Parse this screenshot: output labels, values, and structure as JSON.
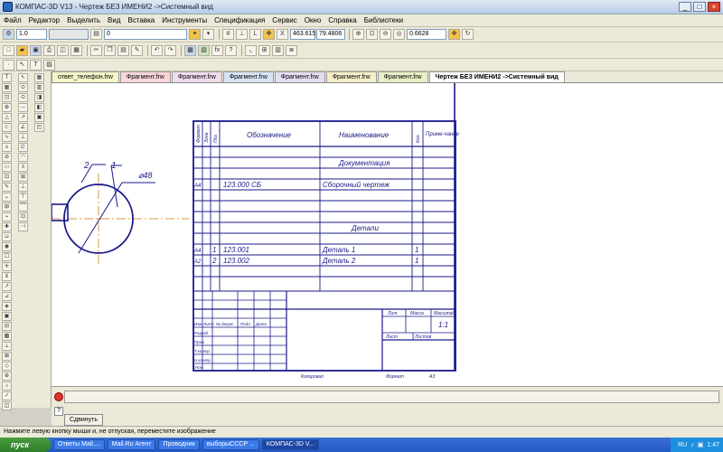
{
  "window": {
    "title": "КОМПАС-3D V13 - Чертеж БЕЗ ИМЕНИ2 ->Системный вид"
  },
  "menu": [
    "Файл",
    "Редактор",
    "Выделить",
    "Вид",
    "Вставка",
    "Инструменты",
    "Спецификация",
    "Сервис",
    "Окно",
    "Справка",
    "Библиотеки"
  ],
  "toolbar1": {
    "line_scale": "1.0",
    "style_value": "0",
    "coord_x": "463.615",
    "coord_y": "79.4806",
    "zoom": "0.6628"
  },
  "tabs": [
    {
      "label": "ответ_телефон.frw",
      "color": "#f6f6c8"
    },
    {
      "label": "Фрагмент.frw",
      "color": "#f8d6da"
    },
    {
      "label": "Фрагмент.frw",
      "color": "#f0dcec"
    },
    {
      "label": "Фрагмент.frw",
      "color": "#d8e4f4"
    },
    {
      "label": "Фрагмент.frw",
      "color": "#e4ddf2"
    },
    {
      "label": "Фрагмент.frw",
      "color": "#f6eec8"
    },
    {
      "label": "Фрагмент.frw",
      "color": "#e6f0c4"
    },
    {
      "label": "Чертеж БЕЗ ИМЕНИ2 ->Системный вид",
      "color": "#ffffff"
    }
  ],
  "drawing": {
    "leader_1": "1",
    "leader_2": "2",
    "diameter": "⌀48",
    "head": {
      "format": "Формат",
      "zone": "Зона",
      "pos": "Поз.",
      "designation": "Обозначение",
      "name": "Наименование",
      "qty": "Кол.",
      "note": "Приме-чание"
    },
    "section_doc": "Документация",
    "row_doc": {
      "format": "А4",
      "designation": "123.000 СБ",
      "name": "Сборочный чертеж"
    },
    "section_parts": "Детали",
    "part_rows": [
      {
        "format": "А4",
        "pos": "1",
        "designation": "123.001",
        "name": "Деталь 1",
        "qty": "1"
      },
      {
        "format": "А2",
        "pos": "2",
        "designation": "123.002",
        "name": "Деталь 2",
        "qty": "1"
      }
    ],
    "stamp": {
      "izm": "Изм.",
      "list": "Лист",
      "doc": "№ докум.",
      "sign": "Подп.",
      "date": "Дата",
      "razrab": "Разраб.",
      "prov": "Пров.",
      "tkontr": "Т.контр.",
      "nkontr": "Н.контр.",
      "utv": "Утв.",
      "lit": "Лит.",
      "mass": "Масса",
      "scale": "Масштаб",
      "scale_value": "1:1",
      "sheet": "Лист",
      "sheets": "Листов",
      "copied": "Копировал",
      "format": "Формат",
      "format_value": "А3"
    }
  },
  "command": {
    "move_button": "Сдвинуть"
  },
  "status": "Нажмите левую кнопку мыши и, не отпуская, переместите изображение",
  "taskbar": {
    "start": "пуск",
    "items": [
      "Ответы Mail....",
      "Mail.Ru Агент",
      "Проводник",
      "выборыСССР ...",
      "КОМПАС-3D V..."
    ],
    "active": "КОМПАС-3D V...",
    "lang": "RU",
    "time": "1:47"
  }
}
